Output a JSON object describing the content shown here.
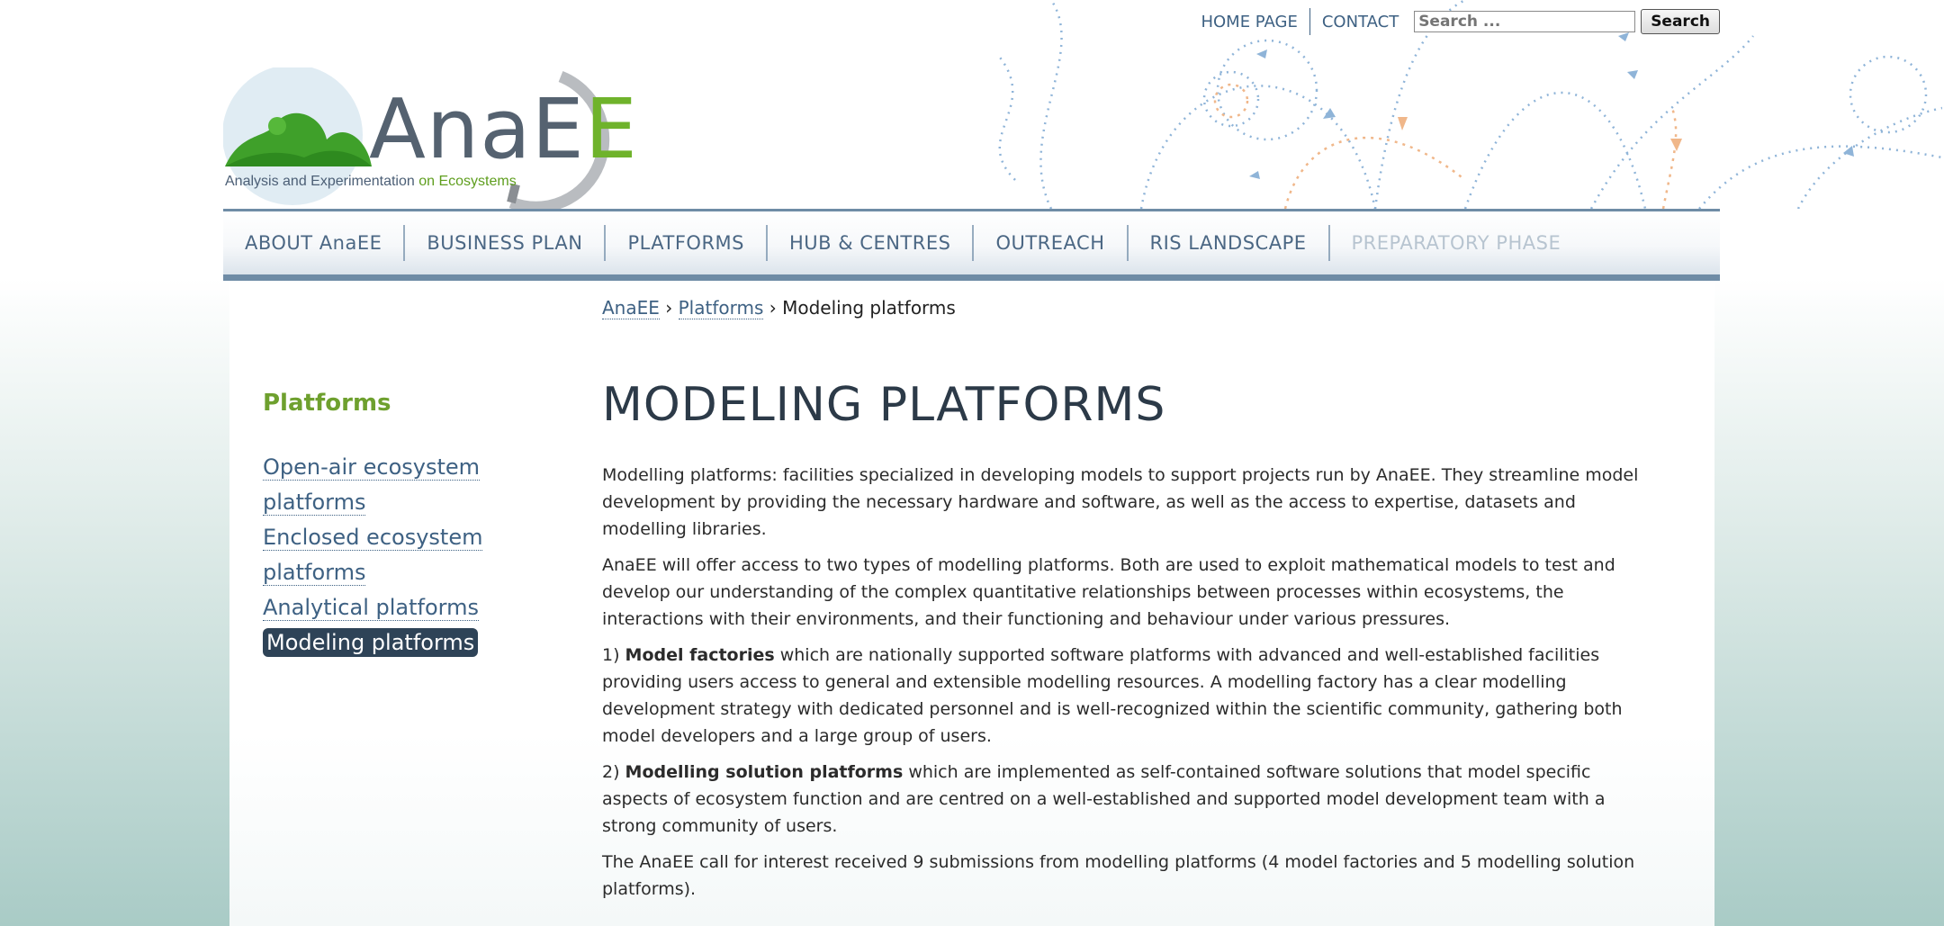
{
  "header": {
    "top_links": [
      "HOME PAGE",
      "CONTACT"
    ],
    "search": {
      "placeholder": "Search ...",
      "button": "Search"
    },
    "logo": {
      "name_prefix": "Ana",
      "name_e1": "E",
      "name_e2": "E",
      "tagline_main": "Analysis and Experimentation ",
      "tagline_accent": "on Ecosystems"
    }
  },
  "nav": {
    "items": [
      "ABOUT AnaEE",
      "BUSINESS PLAN",
      "PLATFORMS",
      "HUB & CENTRES",
      "OUTREACH",
      "RIS LANDSCAPE",
      "PREPARATORY PHASE"
    ]
  },
  "breadcrumb": {
    "home": "AnaEE",
    "sep1": "›",
    "section": "Platforms",
    "sep2": "›",
    "current": "Modeling platforms"
  },
  "sidebar": {
    "title": "Platforms",
    "items": [
      "Open-air ecosystem platforms",
      "Enclosed ecosystem platforms",
      "Analytical platforms",
      "Modeling platforms"
    ]
  },
  "main": {
    "title": "MODELING PLATFORMS",
    "p1": "Modelling platforms: facilities specialized in developing models to support projects run by AnaEE. They streamline model development by providing the necessary hardware and software, as well as the access to expertise, datasets and modelling libraries.",
    "p2": "AnaEE will offer access to two types of modelling platforms. Both are used to exploit mathematical models to test and develop our understanding of the complex quantitative relationships between processes within ecosystems, the interactions with their environments, and their functioning and behaviour under various pressures.",
    "p3_prefix": "1) ",
    "p3_bold": "Model factories",
    "p3_text": " which are nationally supported software platforms with advanced and well-established facilities providing users access to general and extensible modelling resources. A modelling factory has a clear modelling development strategy with dedicated personnel and is well-recognized within the scientific community, gathering both model developers and a large group of users.",
    "p4_prefix": "2) ",
    "p4_bold": "Modelling solution platforms",
    "p4_text": " which are implemented as self-contained software solutions that model specific aspects of ecosystem function and are centred on a well-established and supported model development team with a strong community of users.",
    "p5": "The AnaEE call for interest received 9 submissions from modelling platforms (4 model factories and 5 modelling solution platforms)."
  }
}
